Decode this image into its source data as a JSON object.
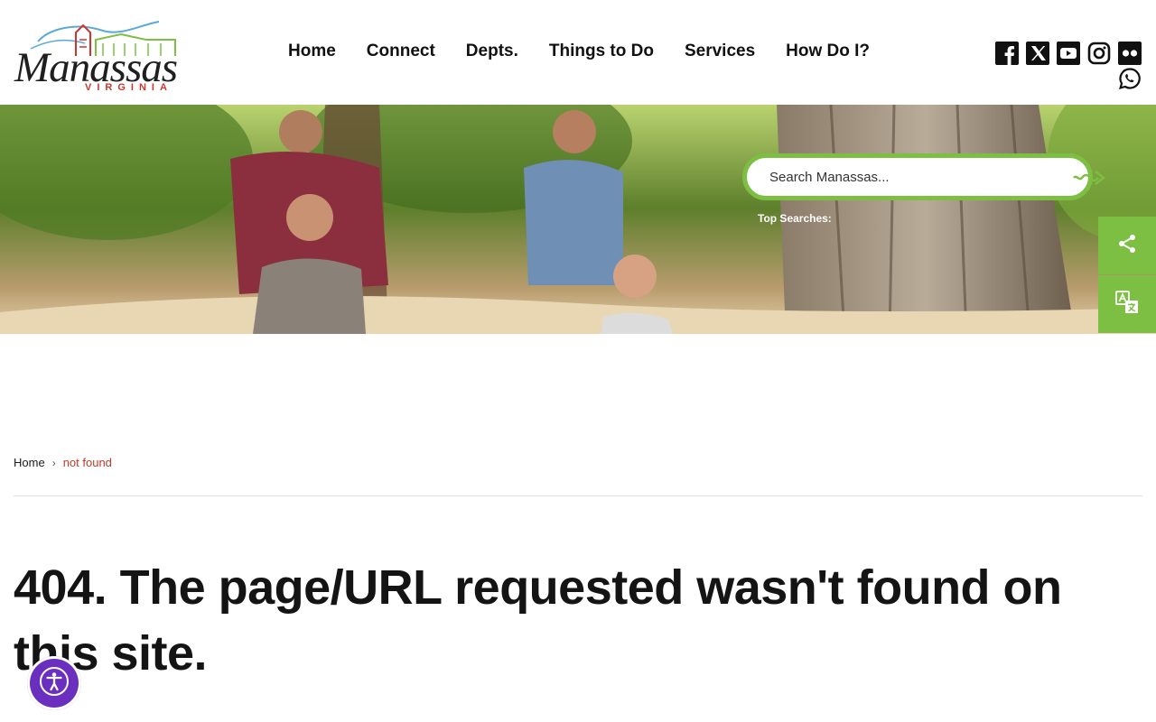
{
  "logo": {
    "name": "Manassas",
    "sub": "VIRGINIA"
  },
  "nav": {
    "items": [
      {
        "label": "Home"
      },
      {
        "label": "Connect"
      },
      {
        "label": "Depts."
      },
      {
        "label": "Things to Do"
      },
      {
        "label": "Services"
      },
      {
        "label": "How Do I?"
      }
    ]
  },
  "social": {
    "icons": [
      "facebook-icon",
      "x-twitter-icon",
      "youtube-icon",
      "instagram-icon",
      "flickr-icon",
      "whatsapp-icon"
    ]
  },
  "search": {
    "placeholder": "Search Manassas...",
    "top_searches_label": "Top Searches:"
  },
  "side_tools": {
    "icons": [
      "share-icon",
      "translate-icon"
    ]
  },
  "breadcrumb": {
    "home": "Home",
    "separator": "›",
    "current": "not found"
  },
  "main": {
    "title": "404. The page/URL requested wasn't found on this site."
  },
  "colors": {
    "accent_green": "#7cbf43",
    "breadcrumb_current": "#c0392b",
    "accessibility_purple": "#6b2fbf"
  }
}
